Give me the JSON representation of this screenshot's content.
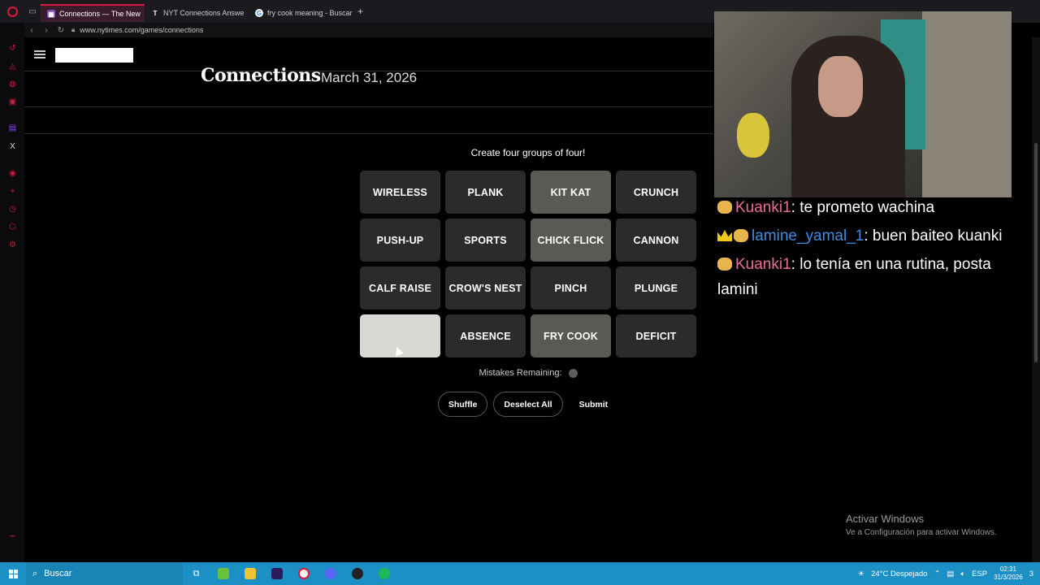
{
  "browser": {
    "tabs": [
      {
        "title": "Connections — The New",
        "active": true
      },
      {
        "title": "NYT Connections Answe",
        "active": false
      },
      {
        "title": "fry cook meaning - Buscar",
        "active": false
      }
    ],
    "url": "www.nytimes.com/games/connections"
  },
  "game": {
    "title": "Connections",
    "date": "March 31, 2026",
    "instructions": "Create four groups of four!",
    "tiles": [
      {
        "label": "WIRELESS",
        "state": "normal"
      },
      {
        "label": "PLANK",
        "state": "normal"
      },
      {
        "label": "KIT KAT",
        "state": "selected"
      },
      {
        "label": "CRUNCH",
        "state": "normal"
      },
      {
        "label": "PUSH-UP",
        "state": "normal"
      },
      {
        "label": "SPORTS",
        "state": "normal"
      },
      {
        "label": "CHICK FLICK",
        "state": "selected"
      },
      {
        "label": "CANNON",
        "state": "normal"
      },
      {
        "label": "CALF RAISE",
        "state": "normal"
      },
      {
        "label": "CROW'S NEST",
        "state": "normal"
      },
      {
        "label": "PINCH",
        "state": "normal"
      },
      {
        "label": "PLUNGE",
        "state": "normal"
      },
      {
        "label": "",
        "state": "hover"
      },
      {
        "label": "ABSENCE",
        "state": "normal"
      },
      {
        "label": "FRY COOK",
        "state": "selected"
      },
      {
        "label": "DEFICIT",
        "state": "normal"
      }
    ],
    "mistakes_label": "Mistakes Remaining:",
    "mistakes_remaining": 1,
    "buttons": {
      "shuffle": "Shuffle",
      "deselect": "Deselect All",
      "submit": "Submit"
    }
  },
  "chat": [
    {
      "user": "Kuanki1",
      "color": "#e86e9a",
      "crown": false,
      "text": ": te prometo wachina"
    },
    {
      "user": "lamine_yamal_1",
      "color": "#3a8ee6",
      "crown": true,
      "text": ": buen baiteo kuanki"
    },
    {
      "user": "Kuanki1",
      "color": "#e86e9a",
      "crown": false,
      "text": ": lo tenía en una rutina, posta lamini"
    }
  ],
  "windows_notice": {
    "line1": "Activar Windows",
    "line2": "Ve a Configuración para activar Windows."
  },
  "taskbar": {
    "search": "Buscar",
    "weather": "24°C  Despejado",
    "lang": "ESP",
    "time": "02:31",
    "date": "31/3/2026",
    "notifications": "3"
  }
}
